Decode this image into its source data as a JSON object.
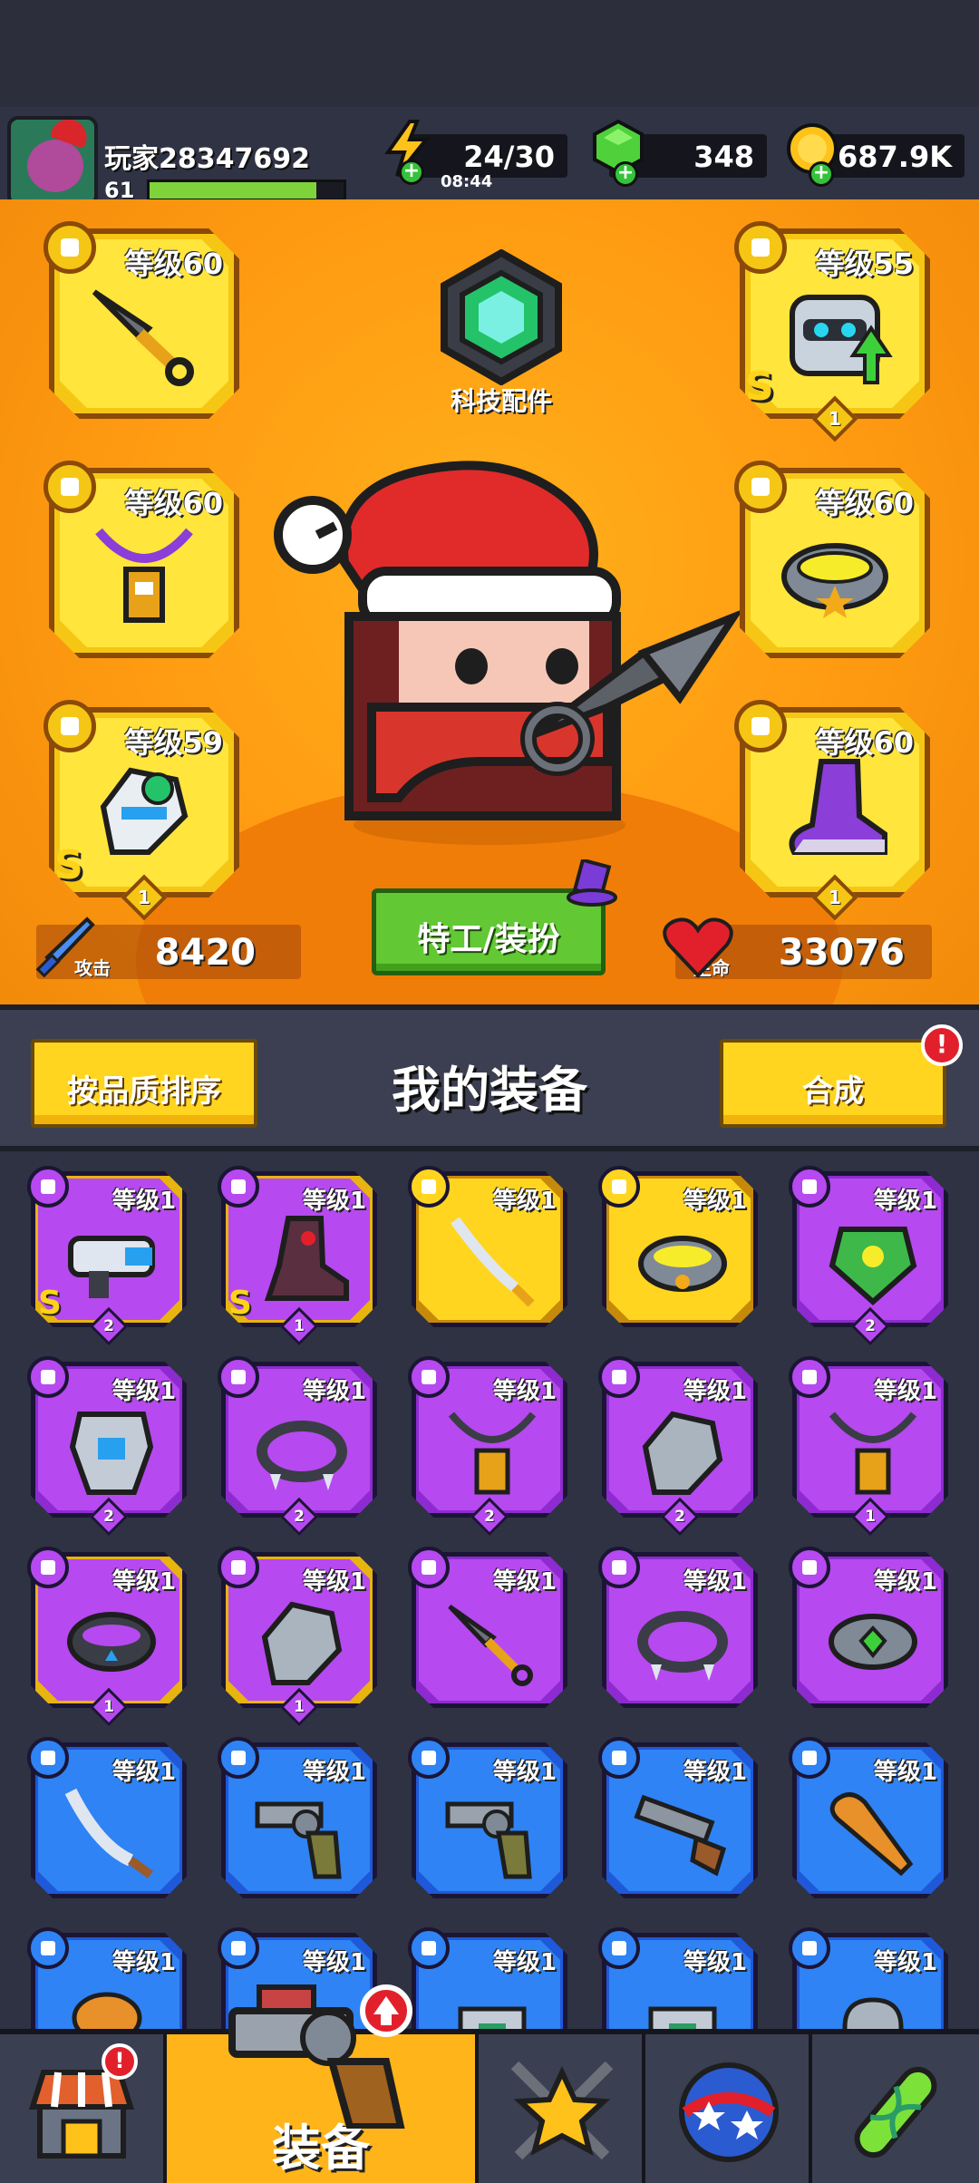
{
  "player": {
    "name": "玩家28347692",
    "level": "61",
    "xp_fraction": 0.86
  },
  "resources": {
    "energy": "24/30",
    "energy_timer": "08:44",
    "gems": "348",
    "coins": "687.9K"
  },
  "hero_panel": {
    "tech_label": "科技配件",
    "slots": [
      {
        "level": "等级60"
      },
      {
        "level": "等级55",
        "grade": "S",
        "stars": "1"
      },
      {
        "level": "等级60"
      },
      {
        "level": "等级60"
      },
      {
        "level": "等级59",
        "grade": "S",
        "stars": "1"
      },
      {
        "level": "等级60",
        "stars": "1"
      }
    ],
    "attack_label": "攻击",
    "attack_value": "8420",
    "hp_label": "生命",
    "hp_value": "33076",
    "agent_button": "特工/装扮"
  },
  "equipment": {
    "sort_button": "按品质排序",
    "title": "我的装备",
    "merge_button": "合成",
    "merge_alert": "!",
    "items": [
      {
        "level": "等级1",
        "grade": "S",
        "stars": "2"
      },
      {
        "level": "等级1",
        "grade": "S",
        "stars": "1"
      },
      {
        "level": "等级1"
      },
      {
        "level": "等级1"
      },
      {
        "level": "等级1",
        "stars": "2"
      },
      {
        "level": "等级1",
        "stars": "2"
      },
      {
        "level": "等级1",
        "stars": "2"
      },
      {
        "level": "等级1",
        "stars": "2"
      },
      {
        "level": "等级1",
        "stars": "2"
      },
      {
        "level": "等级1",
        "stars": "1"
      },
      {
        "level": "等级1",
        "stars": "1"
      },
      {
        "level": "等级1",
        "stars": "1"
      },
      {
        "level": "等级1"
      },
      {
        "level": "等级1"
      },
      {
        "level": "等级1"
      },
      {
        "level": "等级1"
      },
      {
        "level": "等级1"
      },
      {
        "level": "等级1"
      },
      {
        "level": "等级1"
      },
      {
        "level": "等级1"
      },
      {
        "level": "等级1"
      },
      {
        "level": "等级1"
      },
      {
        "level": "等级1"
      },
      {
        "level": "等级1"
      },
      {
        "level": "等级1"
      }
    ]
  },
  "nav": {
    "shop_alert": "!",
    "equip_label": "装备"
  }
}
